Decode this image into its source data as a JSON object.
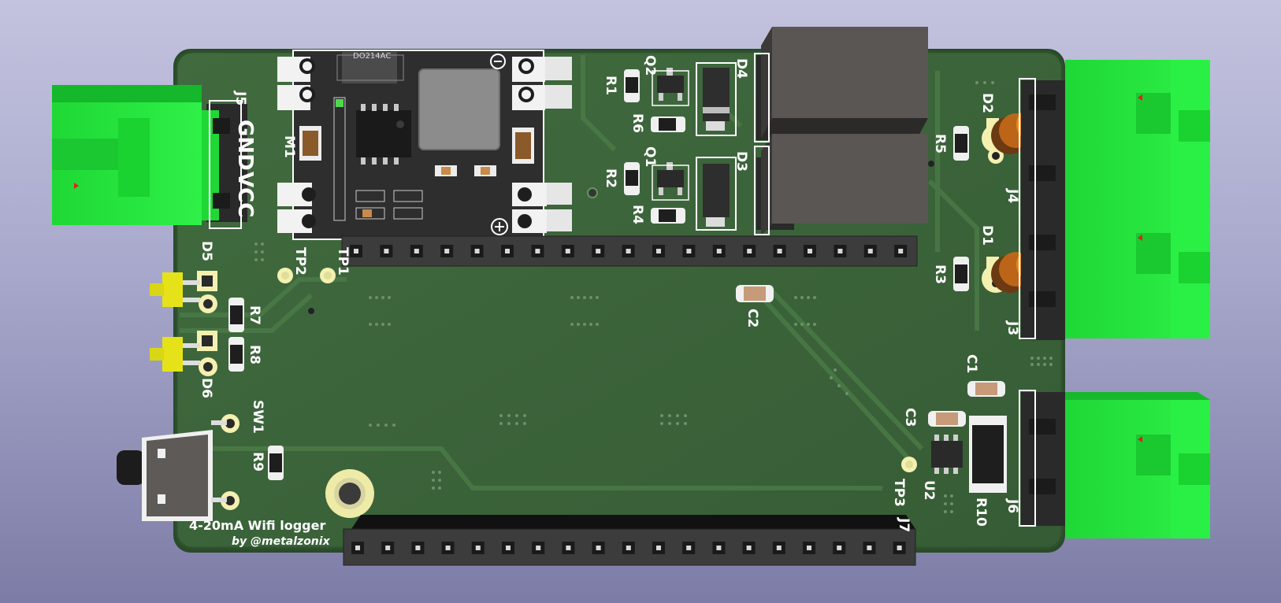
{
  "board": {
    "title_line1": "4-20mA Wifi logger",
    "title_line2": "by @metalzonix",
    "module_part": "DO214AC"
  },
  "labels": {
    "j5": "J5",
    "gnd": "GND",
    "vcc": "VCC",
    "m1": "M1",
    "tp2": "TP2",
    "tp1": "TP1",
    "tp3": "TP3",
    "d5": "D5",
    "d6": "D6",
    "r7": "R7",
    "r8": "R8",
    "r9": "R9",
    "sw1": "SW1",
    "r1": "R1",
    "r2": "R2",
    "r3": "R3",
    "r4": "R4",
    "r5": "R5",
    "r6": "R6",
    "r10": "R10",
    "q1": "Q1",
    "q2": "Q2",
    "d1": "D1",
    "d2": "D2",
    "d3": "D3",
    "d4": "D4",
    "c1": "C1",
    "c2": "C2",
    "c3": "C3",
    "u2": "U2",
    "j3": "J3",
    "j4": "J4",
    "j6": "J6",
    "j7": "J7"
  },
  "colors": {
    "pcb": "#3a6238",
    "pcb_edge": "#2d4f2c",
    "terminal": "#22e83a",
    "header": "#3a3a3a",
    "relay": "#585452",
    "led_yellow": "#e6e21a",
    "led_orange": "#e88a1a",
    "silkscreen": "#ffffff"
  }
}
